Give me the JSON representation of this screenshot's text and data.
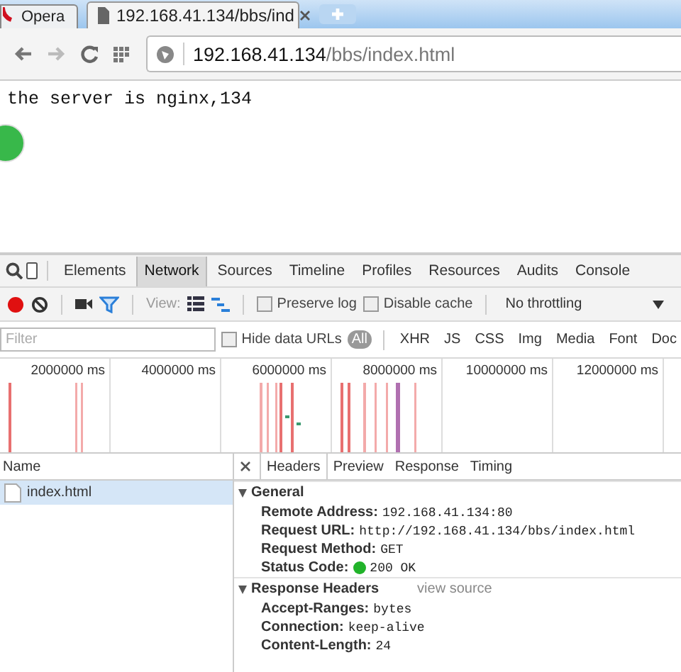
{
  "browser": {
    "tabs": [
      {
        "label": "Opera",
        "selected": false
      },
      {
        "label": "192.168.41.134/bbs/ind",
        "selected": true
      }
    ],
    "address": {
      "host": "192.168.41.134",
      "path": "/bbs/index.html"
    }
  },
  "page": {
    "text": "the server is nginx,134"
  },
  "devtools": {
    "tabs": [
      {
        "label": "Elements",
        "selected": false
      },
      {
        "label": "Network",
        "selected": true
      },
      {
        "label": "Sources",
        "selected": false
      },
      {
        "label": "Timeline",
        "selected": false
      },
      {
        "label": "Profiles",
        "selected": false
      },
      {
        "label": "Resources",
        "selected": false
      },
      {
        "label": "Audits",
        "selected": false
      },
      {
        "label": "Console",
        "selected": false
      }
    ],
    "toolbar": {
      "recording": true,
      "filter_on": true,
      "view_label": "View:",
      "checkboxes": [
        {
          "label": "Preserve log",
          "checked": false
        },
        {
          "label": "Disable cache",
          "checked": false
        }
      ],
      "throttling": "No throttling"
    },
    "filter": {
      "placeholder": "Filter",
      "hide_data_urls": {
        "label": "Hide data URLs",
        "checked": false
      },
      "types": [
        {
          "label": "All",
          "selected": true
        },
        {
          "label": "XHR",
          "selected": false
        },
        {
          "label": "JS",
          "selected": false
        },
        {
          "label": "CSS",
          "selected": false
        },
        {
          "label": "Img",
          "selected": false
        },
        {
          "label": "Media",
          "selected": false
        },
        {
          "label": "Font",
          "selected": false
        },
        {
          "label": "Doc",
          "selected": false
        }
      ]
    },
    "overview": {
      "ticks": [
        "2000000 ms",
        "4000000 ms",
        "6000000 ms",
        "8000000 ms",
        "10000000 ms",
        "12000000 ms"
      ]
    },
    "requests": {
      "column": "Name",
      "rows": [
        {
          "name": "index.html",
          "selected": true
        }
      ]
    },
    "detail": {
      "tabs": [
        {
          "label": "Headers",
          "selected": true
        },
        {
          "label": "Preview",
          "selected": false
        },
        {
          "label": "Response",
          "selected": false
        },
        {
          "label": "Timing",
          "selected": false
        }
      ],
      "sections": [
        {
          "title": "General",
          "expanded": true,
          "headers": [
            {
              "kind": "text",
              "name": "Remote Address:",
              "value": "192.168.41.134:80"
            },
            {
              "kind": "text",
              "name": "Request URL:",
              "value": "http://192.168.41.134/bbs/index.html"
            },
            {
              "kind": "text",
              "name": "Request Method:",
              "value": "GET"
            },
            {
              "kind": "status",
              "name": "Status Code:",
              "value": "200 OK"
            }
          ]
        },
        {
          "title": "Response Headers",
          "expanded": true,
          "link": "view source",
          "headers": [
            {
              "kind": "text",
              "name": "Accept-Ranges:",
              "value": "bytes"
            },
            {
              "kind": "text",
              "name": "Connection:",
              "value": "keep-alive"
            },
            {
              "kind": "text",
              "name": "Content-Length:",
              "value": "24"
            }
          ]
        }
      ]
    }
  }
}
